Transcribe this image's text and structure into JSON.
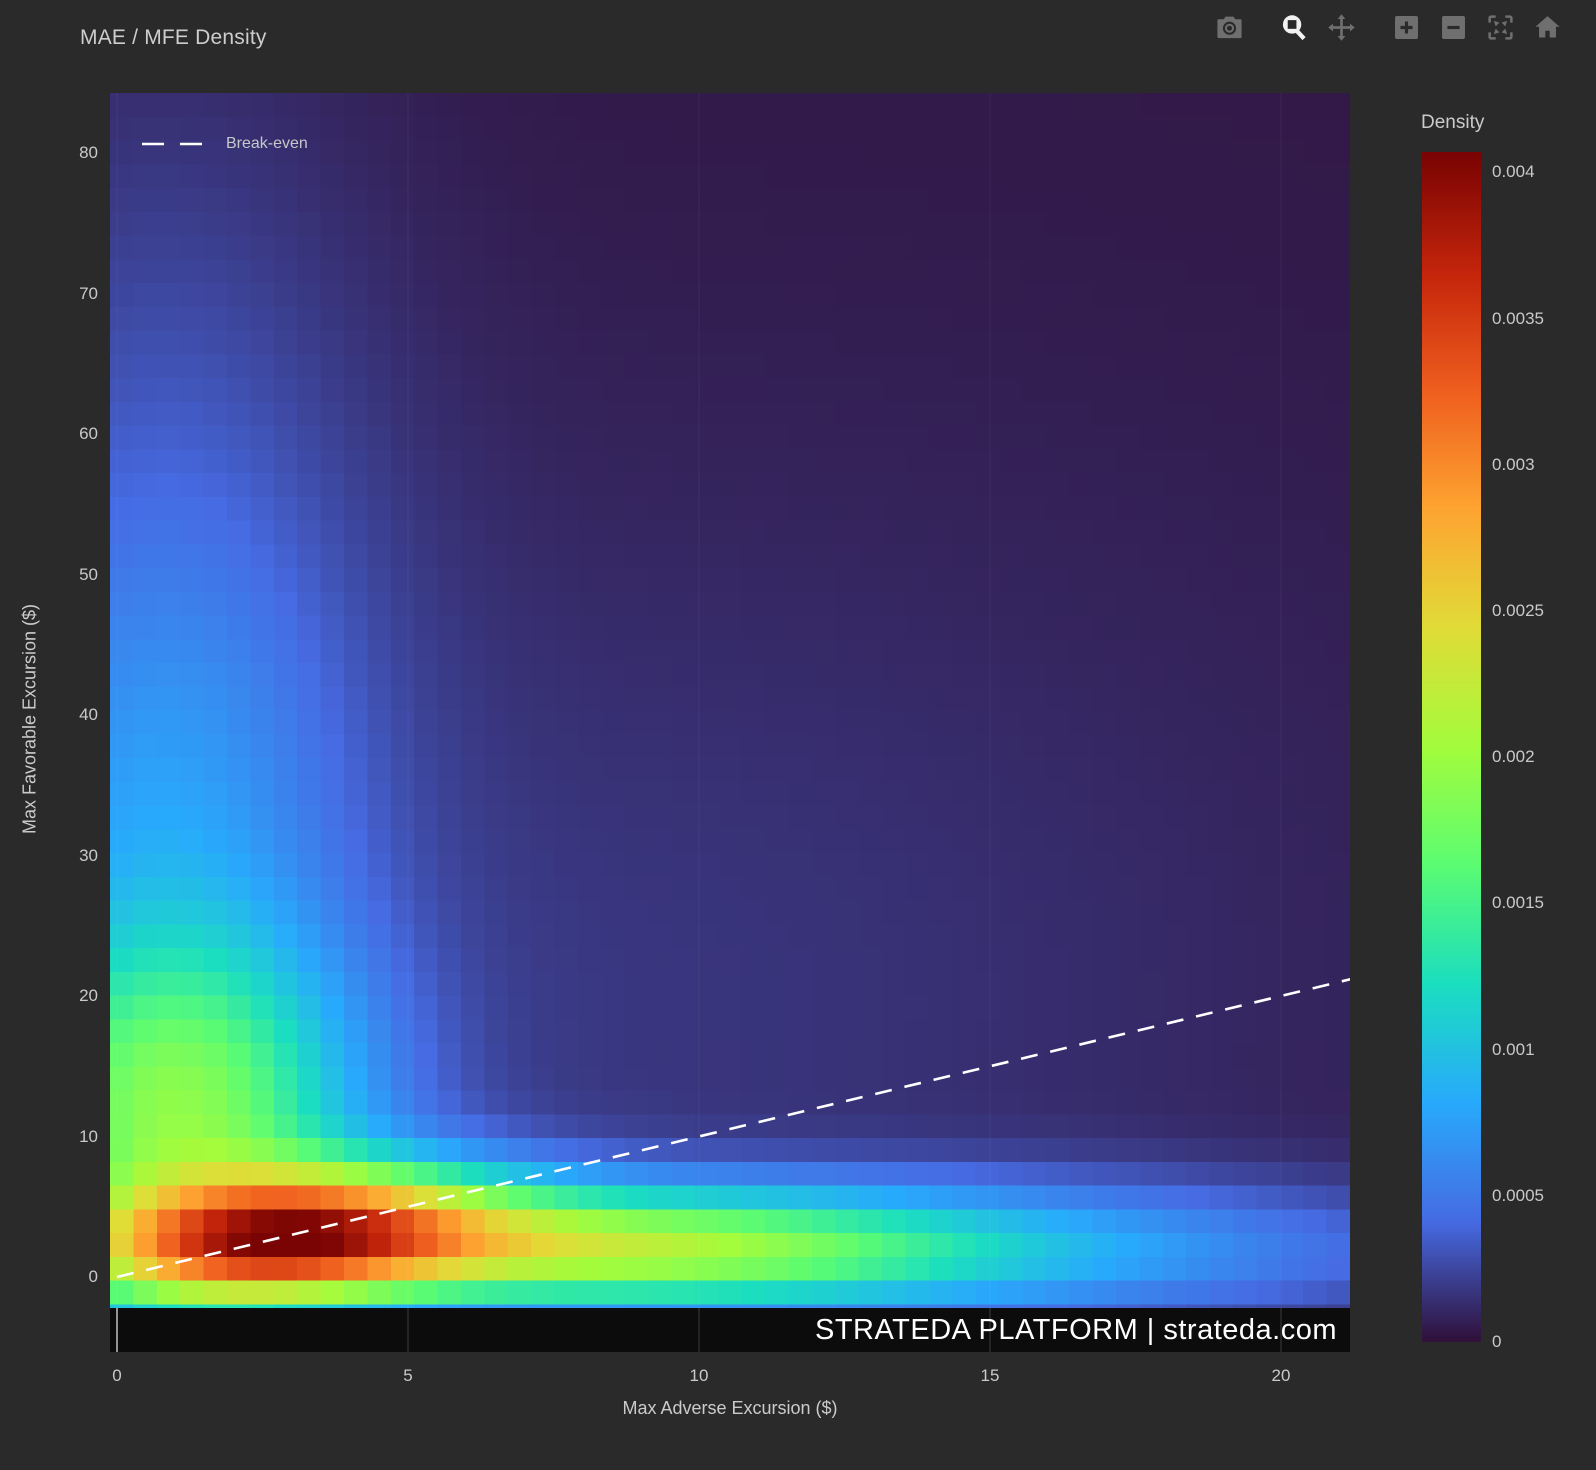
{
  "window": {
    "background": "#2a2a2a"
  },
  "header": {
    "title": "MAE / MFE Density"
  },
  "modebar": {
    "icons": [
      "camera",
      "zoom",
      "pan",
      "zoom-in",
      "zoom-out",
      "autoscale",
      "reset-home"
    ],
    "active_icon": "zoom",
    "inactive_color": "#6f6f6f",
    "active_color": "#f2f2f2"
  },
  "chart_data": {
    "type": "heatmap",
    "title": "MAE / MFE Density",
    "xlabel": "Max Adverse Excursion ($)",
    "ylabel": "Max Favorable Excursion ($)",
    "xlim": [
      -0.12,
      21.19
    ],
    "ylim": [
      -5.34,
      84.27
    ],
    "x_ticks": [
      0,
      5,
      10,
      15,
      20
    ],
    "y_ticks": [
      0,
      10,
      20,
      30,
      40,
      50,
      60,
      70,
      80
    ],
    "grid": {
      "cols": 53,
      "rows": 53,
      "grid_lines_on": true
    },
    "colorbar": {
      "title": "Density",
      "zmin": 0,
      "zmax": 0.00407,
      "tick_values": [
        0,
        0.0005,
        0.001,
        0.0015,
        0.002,
        0.0025,
        0.003,
        0.0035,
        0.004
      ],
      "tick_labels": [
        "0",
        "0.0005",
        "0.001",
        "0.0015",
        "0.002",
        "0.0025",
        "0.003",
        "0.0035",
        "0.004"
      ],
      "colormap": "turbo",
      "colormap_stops": [
        "#30123b",
        "#466be3",
        "#28aafc",
        "#1bdec0",
        "#5bfc73",
        "#a3fc3c",
        "#e1dc37",
        "#fea531",
        "#ef5f1f",
        "#c4250b",
        "#7a0403"
      ]
    },
    "legend": [
      {
        "label": "Break-even",
        "style": "dashed-line",
        "color": "#ffffff",
        "position": "top-left-inside"
      }
    ],
    "breakeven_line": {
      "from_xy": [
        0,
        0
      ],
      "to_xy": [
        21.19,
        21.19
      ],
      "dash": "dashed",
      "color": "#ffffff"
    },
    "watermark": "STRATEDA PLATFORM | strateda.com",
    "colors": {
      "paper_background": "#2a2a2a",
      "watermark_band": "#0c0c0c",
      "watermark_text": "#ffffff",
      "tick_text": "#c9c9c9",
      "title_text": "#cdcdcd",
      "density_low": "#30123b",
      "density_high": "#7a0403"
    },
    "density_model": {
      "kind": "gaussian_mixture",
      "note": "z(x,y) = sum of a*exp(-0.5*((u/sx)^2+(v/sy)^2)); u,v rotated by rot degrees",
      "components": [
        {
          "a": 0.0024,
          "x": 3.1,
          "y": 3.0,
          "sx": 2.2,
          "sy": 3.4,
          "rot": -18
        },
        {
          "a": 0.0018,
          "x": 8.0,
          "y": 2.0,
          "sx": 4.5,
          "sy": 2.9,
          "rot": 0
        },
        {
          "a": 0.00055,
          "x": 15.5,
          "y": 1.8,
          "sx": 5.5,
          "sy": 3.6,
          "rot": 0
        },
        {
          "a": 0.0016,
          "x": 1.0,
          "y": 11.0,
          "sx": 2.2,
          "sy": 9.0,
          "rot": 0
        },
        {
          "a": 0.0005,
          "x": 0.7,
          "y": 32.0,
          "sx": 2.3,
          "sy": 14.0,
          "rot": 0
        },
        {
          "a": 0.00022,
          "x": 0.7,
          "y": 58.0,
          "sx": 2.7,
          "sy": 20.0,
          "rot": 0
        },
        {
          "a": 0.00013,
          "x": 7.0,
          "y": 18.0,
          "sx": 10.0,
          "sy": 26.0,
          "rot": 0
        },
        {
          "a": 4e-05,
          "x": 10.0,
          "y": 45.0,
          "sx": 26.0,
          "sy": 60.0,
          "rot": 0
        }
      ]
    }
  }
}
